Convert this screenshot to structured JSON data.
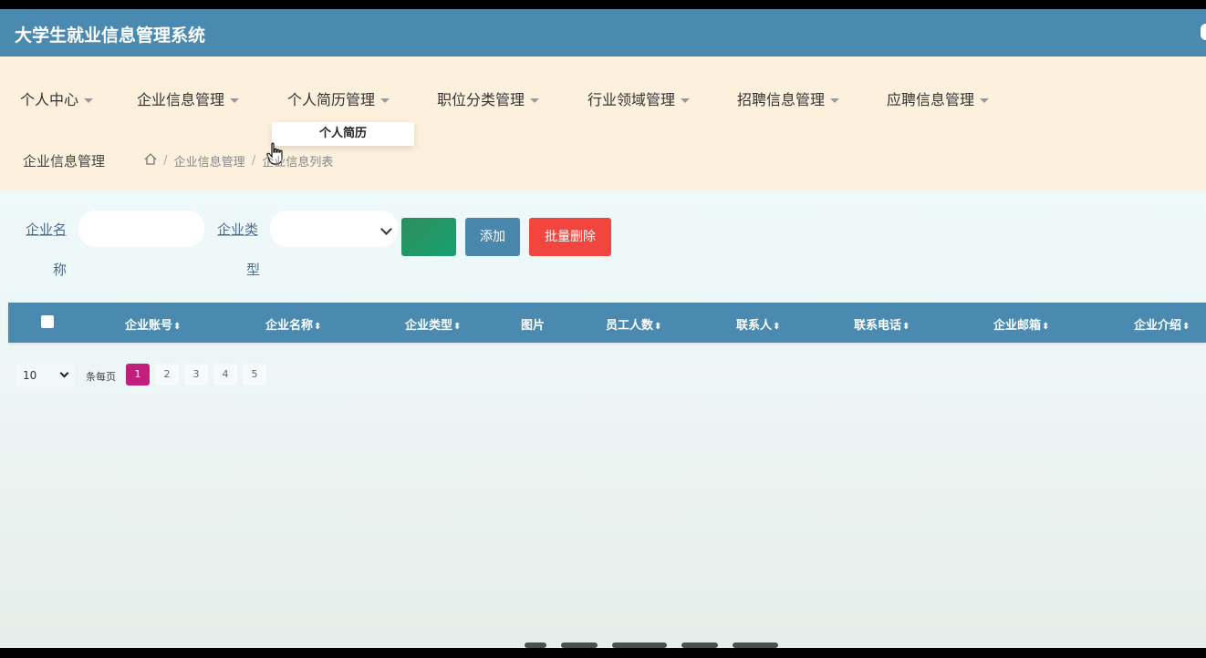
{
  "app": {
    "title": "大学生就业信息管理系统"
  },
  "menu": [
    {
      "label": "个人中心"
    },
    {
      "label": "企业信息管理"
    },
    {
      "label": "个人简历管理"
    },
    {
      "label": "职位分类管理"
    },
    {
      "label": "行业领域管理"
    },
    {
      "label": "招聘信息管理"
    },
    {
      "label": "应聘信息管理"
    }
  ],
  "dropdown": {
    "item": "个人简历"
  },
  "breadcrumb": {
    "title": "企业信息管理",
    "path": [
      "企业信息管理",
      "企业信息列表"
    ],
    "separator": "/"
  },
  "search": {
    "name_label_1": "企业名",
    "name_label_2": "称",
    "name_value": "",
    "type_label_1": "企业类",
    "type_label_2": "型",
    "type_value": "",
    "add_label": "添加",
    "batch_delete_label": "批量删除"
  },
  "table": {
    "columns": [
      {
        "label": "企业账号",
        "sortable": true
      },
      {
        "label": "企业名称",
        "sortable": true
      },
      {
        "label": "企业类型",
        "sortable": true
      },
      {
        "label": "图片",
        "sortable": false
      },
      {
        "label": "员工人数",
        "sortable": true
      },
      {
        "label": "联系人",
        "sortable": true
      },
      {
        "label": "联系电话",
        "sortable": true
      },
      {
        "label": "企业邮箱",
        "sortable": true
      },
      {
        "label": "企业介绍",
        "sortable": true
      }
    ],
    "sort_glyph": "⬍"
  },
  "pager": {
    "page_size": "10",
    "label": "条每页",
    "pages": [
      "1",
      "2",
      "3",
      "4",
      "5"
    ],
    "current": "1"
  },
  "colors": {
    "header": "#4a8ab0",
    "nav_bg": "#fdf1de",
    "search_button": "#1f9a6a",
    "add_button": "#4a87ad",
    "delete_button": "#f2453d",
    "active_page": "#c21f7d"
  }
}
